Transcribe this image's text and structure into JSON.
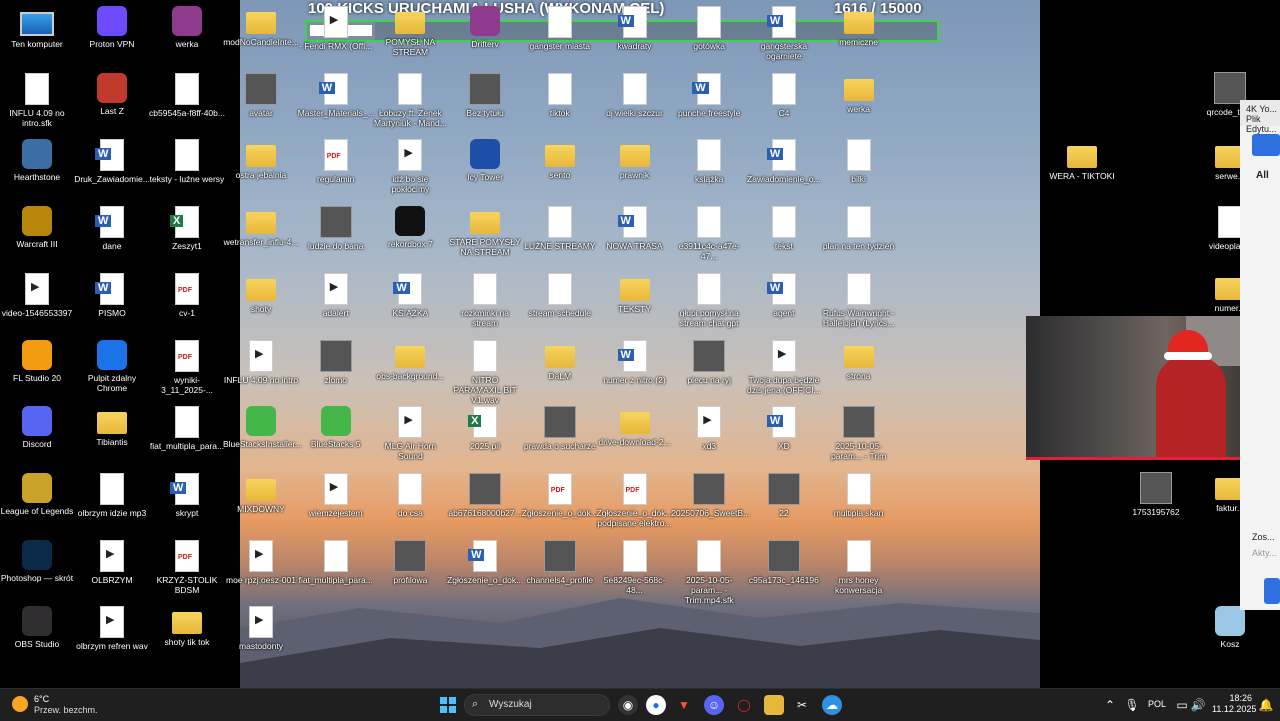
{
  "overlay": {
    "goal_title": "100 KICKS URUCHAMIA LUSHA (WYKONAM CEL)",
    "goal_current": "1616",
    "goal_target": "/ 15000",
    "goal_progress": 0.108
  },
  "desktop_left": [
    {
      "label": "Ten komputer",
      "icon": "pc-icon"
    },
    {
      "label": "Proton VPN",
      "icon": "vpn-icon"
    },
    {
      "label": "werka",
      "icon": "rar-icon"
    },
    {
      "label": "INFLU 4.09 no intro.sfk",
      "icon": "doc-icon"
    },
    {
      "label": "Last Z",
      "icon": "game-icon"
    },
    {
      "label": "cb59545a-f8ff-40b...",
      "icon": "file-icon"
    },
    {
      "label": "Hearthstone",
      "icon": "hearthstone-icon"
    },
    {
      "label": "Druk_Zawiadomie...",
      "icon": "word-icon"
    },
    {
      "label": "teksty - luźne wersy",
      "icon": "doc-icon"
    },
    {
      "label": "Warcraft III",
      "icon": "warcraft-icon"
    },
    {
      "label": "dane",
      "icon": "word-icon"
    },
    {
      "label": "Zeszyt1",
      "icon": "excel-icon"
    },
    {
      "label": "video-1546553397",
      "icon": "video-icon"
    },
    {
      "label": "PISMO",
      "icon": "word-icon"
    },
    {
      "label": "cv-1",
      "icon": "pdf-icon"
    },
    {
      "label": "FL Studio 20",
      "icon": "flstudio-icon"
    },
    {
      "label": "Pulpit zdalny Chrome",
      "icon": "chrome-remote-icon"
    },
    {
      "label": "wyniki-3_11_2025-...",
      "icon": "pdf-icon"
    },
    {
      "label": "Discord",
      "icon": "discord-icon"
    },
    {
      "label": "Tibiantis",
      "icon": "folder-icon"
    },
    {
      "label": "fiat_multipla_para...",
      "icon": "doc-icon"
    },
    {
      "label": "League of Legends",
      "icon": "lol-icon"
    },
    {
      "label": "olbrzym idzie mp3",
      "icon": "media-icon"
    },
    {
      "label": "skrypt",
      "icon": "word-icon"
    },
    {
      "label": "Photoshop — skrót",
      "icon": "photoshop-icon"
    },
    {
      "label": "OLBRZYM",
      "icon": "video-icon"
    },
    {
      "label": "KRZYŻ-STOLIK BDSM",
      "icon": "pdf-icon"
    },
    {
      "label": "OBS Studio",
      "icon": "obs-icon"
    },
    {
      "label": "olbrzym refren wav",
      "icon": "video-icon"
    },
    {
      "label": "shoty tik tok",
      "icon": "folder-icon"
    }
  ],
  "desktop_main": [
    {
      "label": "modNoCandleInte...",
      "icon": "folder-icon"
    },
    {
      "label": "- Fendi RMX (Offi...",
      "icon": "video-icon"
    },
    {
      "label": "POMYSŁ NA STREAM",
      "icon": "folder-icon"
    },
    {
      "label": "Drifterv",
      "icon": "rar-icon"
    },
    {
      "label": "gangster miasta",
      "icon": "doc-icon"
    },
    {
      "label": "kwadraty",
      "icon": "word-icon"
    },
    {
      "label": "gotówka",
      "icon": "doc-icon"
    },
    {
      "label": "gangsterska ogarniete",
      "icon": "word-icon"
    },
    {
      "label": "memiczne",
      "icon": "folder-icon"
    },
    {
      "label": "avatar",
      "icon": "img-icon"
    },
    {
      "label": "Master_Materials_...",
      "icon": "word-icon"
    },
    {
      "label": "Łobuzy ft. Zenek Martyniuk - Mand...",
      "icon": "media-icon"
    },
    {
      "label": "Bez tytułu",
      "icon": "img-icon"
    },
    {
      "label": "tiktok",
      "icon": "doc-icon"
    },
    {
      "label": "dj wielki szczur",
      "icon": "doc-icon"
    },
    {
      "label": "punche freestyle",
      "icon": "word-icon"
    },
    {
      "label": "C4",
      "icon": "doc-icon"
    },
    {
      "label": "werka",
      "icon": "folder-icon"
    },
    {
      "label": "ostra jebalnia",
      "icon": "folder-icon"
    },
    {
      "label": "regulamin",
      "icon": "pdf-icon"
    },
    {
      "label": "idź bo się pokłócimy",
      "icon": "video-icon"
    },
    {
      "label": "Icy Tower",
      "icon": "icytower-icon"
    },
    {
      "label": "sento",
      "icon": "folder-icon"
    },
    {
      "label": "prawnik",
      "icon": "folder-icon"
    },
    {
      "label": "książka",
      "icon": "doc-icon"
    },
    {
      "label": "Zawiadomienie_o...",
      "icon": "word-icon"
    },
    {
      "label": "bilki",
      "icon": "doc-icon"
    },
    {
      "label": "wetransfer_influ-4...",
      "icon": "folder-icon"
    },
    {
      "label": "ludzie do bana",
      "icon": "img-icon"
    },
    {
      "label": "rekordbox 7",
      "icon": "rekordbox-icon"
    },
    {
      "label": "STARE POMYSŁY NA STREAM",
      "icon": "folder-icon"
    },
    {
      "label": "LUŹNE STREAMY",
      "icon": "doc-icon"
    },
    {
      "label": "NOWA TRASA",
      "icon": "word-icon"
    },
    {
      "label": "e3911c4c-a47e-47...",
      "icon": "doc-icon"
    },
    {
      "label": "tekst",
      "icon": "doc-icon"
    },
    {
      "label": "plan na ten tydzień",
      "icon": "doc-icon"
    },
    {
      "label": "shoty",
      "icon": "folder-icon"
    },
    {
      "label": "adalert",
      "icon": "video-icon"
    },
    {
      "label": "KSIĄŻKA",
      "icon": "word-icon"
    },
    {
      "label": "rozkminki na stream",
      "icon": "doc-icon"
    },
    {
      "label": "stream schedule",
      "icon": "doc-icon"
    },
    {
      "label": "TEKSTY",
      "icon": "folder-icon"
    },
    {
      "label": "głupi pomysł na stream chat gpt",
      "icon": "doc-icon"
    },
    {
      "label": "agent",
      "icon": "word-icon"
    },
    {
      "label": "Rufus Wainwright - Hallelujah (Lyrics...",
      "icon": "media-icon"
    },
    {
      "label": "INFLU 4.09 no intro",
      "icon": "video-icon"
    },
    {
      "label": "zlomo",
      "icon": "img-icon"
    },
    {
      "label": "obs-background...",
      "icon": "folder-icon"
    },
    {
      "label": "NITRO PARAMAXIL BIT V1.wav",
      "icon": "media-icon"
    },
    {
      "label": "DaLM",
      "icon": "folder-icon"
    },
    {
      "label": "numer z nitro (2)",
      "icon": "word-icon"
    },
    {
      "label": "piecu na ryj",
      "icon": "img-icon"
    },
    {
      "label": "Twoja dupa będzie dziś jena (OFFICI...",
      "icon": "video-icon"
    },
    {
      "label": "strona",
      "icon": "folder-icon"
    },
    {
      "label": "BlueStacksInstaller...",
      "icon": "bluestacks-icon"
    },
    {
      "label": "BlueStacks 5",
      "icon": "bluestacks-icon"
    },
    {
      "label": "MLG Air Horn Sound",
      "icon": "video-icon"
    },
    {
      "label": "2025 pil",
      "icon": "excel-icon"
    },
    {
      "label": "prawda o sucharze",
      "icon": "img-icon"
    },
    {
      "label": "drive-download-2...",
      "icon": "folder-icon"
    },
    {
      "label": "xd3",
      "icon": "video-icon"
    },
    {
      "label": "XD",
      "icon": "word-icon"
    },
    {
      "label": "2025-10-05-param... - Trim",
      "icon": "img-icon"
    },
    {
      "label": "MIXDOWNY",
      "icon": "folder-icon"
    },
    {
      "label": "wiemżejestem",
      "icon": "video-icon"
    },
    {
      "label": "do csa",
      "icon": "doc-icon"
    },
    {
      "label": "ab676168000b27...",
      "icon": "img-icon"
    },
    {
      "label": "Zgłoszenie_o_dok...",
      "icon": "pdf-icon"
    },
    {
      "label": "Zgłoszenie_o_dok... podpisane elektro...",
      "icon": "pdf-icon"
    },
    {
      "label": "20250706_SweetB...",
      "icon": "img-icon"
    },
    {
      "label": "22",
      "icon": "img-icon"
    },
    {
      "label": "multipla skan",
      "icon": "doc-icon"
    },
    {
      "label": "moe rpzj.oesz-001",
      "icon": "video-icon"
    },
    {
      "label": "fiat_multipla_para...",
      "icon": "doc-icon"
    },
    {
      "label": "profilowa",
      "icon": "img-icon"
    },
    {
      "label": "Zgłoszenie_o_dok...",
      "icon": "word-icon"
    },
    {
      "label": "channels4_profile",
      "icon": "img-icon"
    },
    {
      "label": "5e8249ec-568c-48...",
      "icon": "doc-icon"
    },
    {
      "label": "2025-10-05-param... - Trim.mp4.sfk",
      "icon": "doc-icon"
    },
    {
      "label": "c95a173c_146196",
      "icon": "img-icon"
    },
    {
      "label": "mrs honey konwersacja",
      "icon": "media-icon"
    },
    {
      "label": "mastodonty",
      "icon": "video-icon"
    }
  ],
  "desktop_right": [
    {
      "label": "qrcode_tip...",
      "icon": "qr-icon"
    },
    {
      "label": "WERA - TIKTOKI",
      "icon": "folder-icon"
    },
    {
      "label": "serwe...",
      "icon": "folder-icon"
    },
    {
      "label": "videoplay...",
      "icon": "media-icon"
    },
    {
      "label": "numer...",
      "icon": "folder-icon"
    },
    {
      "label": "1753195762",
      "icon": "qr-icon"
    },
    {
      "label": "faktur...",
      "icon": "folder-icon"
    },
    {
      "label": "Kosz",
      "icon": "recycle-bin-icon"
    }
  ],
  "right_panel": {
    "title": "4K Yo...",
    "menu_file": "Plik",
    "menu_edit": "Edytu...",
    "tab_all": "All",
    "hint1": "Zos...",
    "hint2": "Akty..."
  },
  "taskbar": {
    "weather_temp": "6°C",
    "weather_desc": "Przew. bezchm.",
    "search_placeholder": "Wyszukaj",
    "lang": "POL",
    "time": "18:26",
    "date": "11.12.2025",
    "apps": [
      "start-icon",
      "search-icon",
      "obs-icon",
      "chrome-icon",
      "brave-icon",
      "discord-icon",
      "opera-icon",
      "explorer-icon",
      "capcut-icon",
      "4k-downloader-icon"
    ]
  },
  "colors": {
    "goal_border": "#3fd34d",
    "webcam_border": "#e0213d",
    "taskbar_bg": "#1f1f1f",
    "folder": "#e7b73b",
    "word": "#2b5fb4",
    "excel": "#1f7a45",
    "pdf": "#d0201b"
  }
}
